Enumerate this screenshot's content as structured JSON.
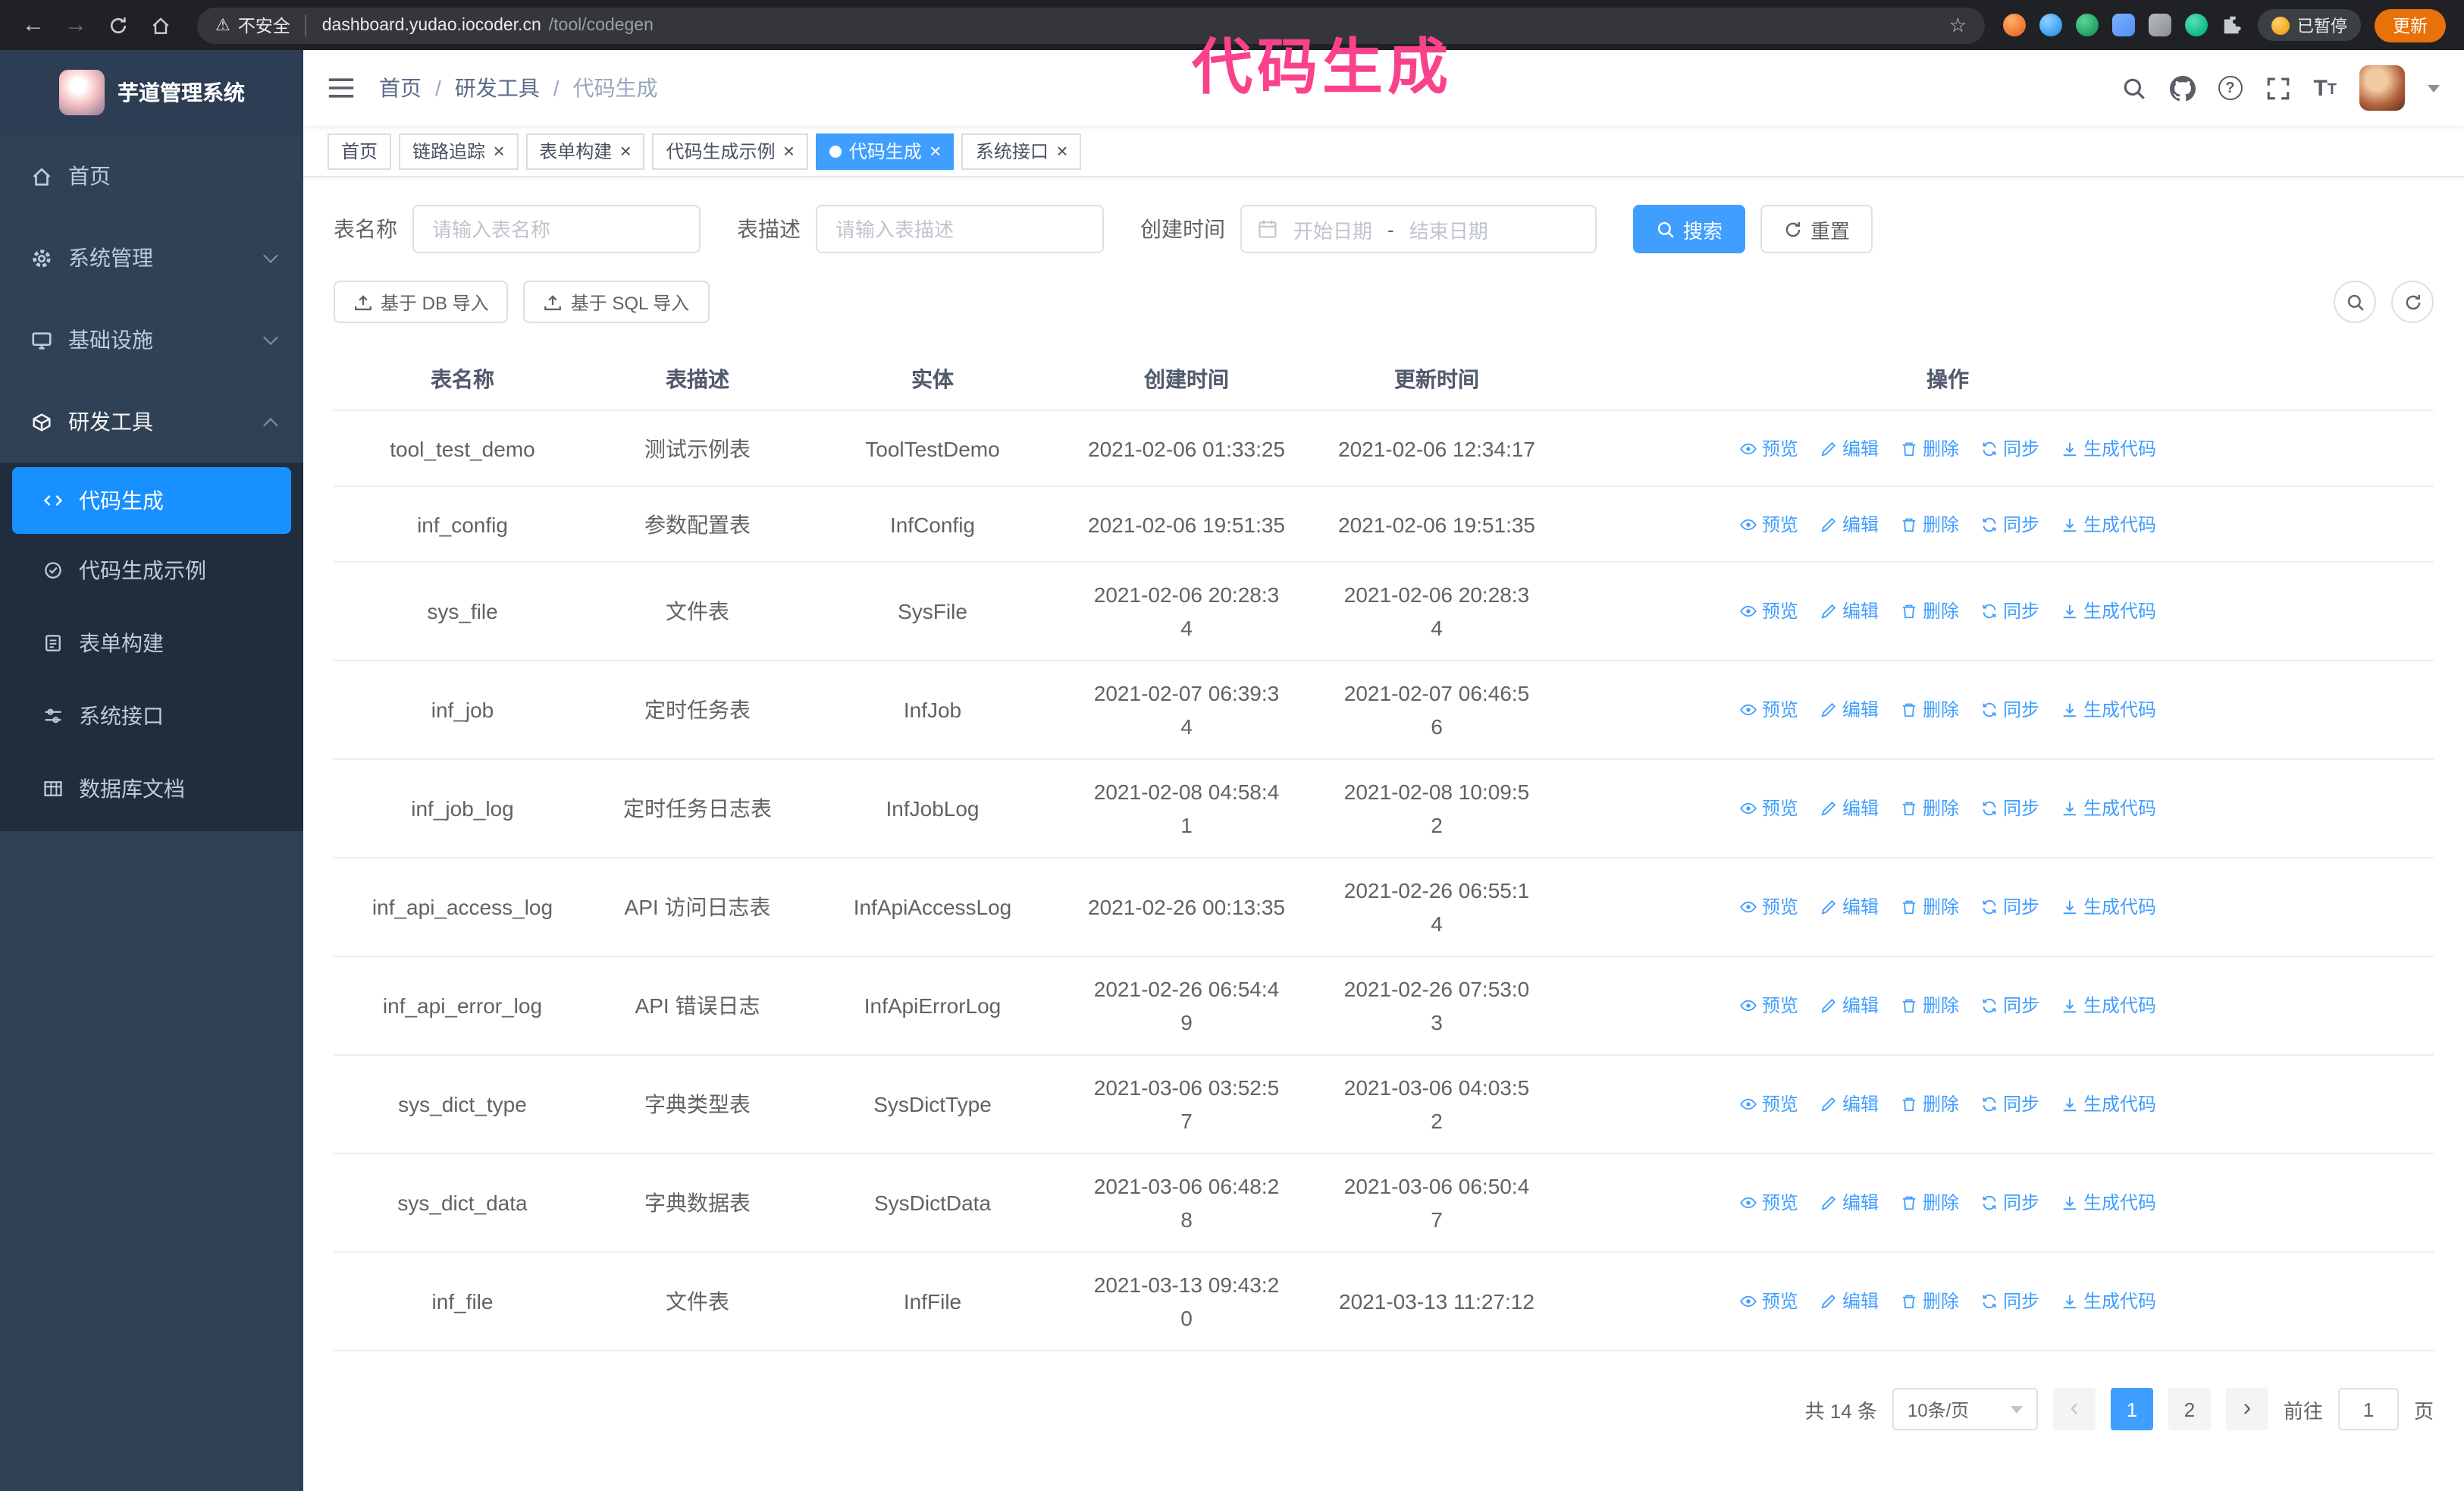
{
  "theme": {
    "accent": "#409eff",
    "sidebar_bg": "#304156",
    "submenu_bg": "#1f2d3d",
    "active_menu_bg": "#1890ff",
    "update_button_bg": "#e8710a",
    "annotation_pink": "#fa418c"
  },
  "browser": {
    "security_label": "不安全",
    "url_host": "dashboard.yudao.iocoder.cn",
    "url_path": "/tool/codegen",
    "paused_badge": "已暂停",
    "update_button": "更新"
  },
  "annotation": {
    "text": "代码生成"
  },
  "glyphs": {
    "back": "←",
    "forward": "→",
    "star": "☆",
    "warning": "⚠",
    "close": "×",
    "crumb_sep": "/",
    "prev": "‹",
    "next": "›",
    "help": "?",
    "font_large": "T",
    "font_small": "T"
  },
  "sidebar": {
    "logo_title": "芋道管理系统",
    "items": [
      {
        "label": "首页"
      },
      {
        "label": "系统管理"
      },
      {
        "label": "基础设施"
      },
      {
        "label": "研发工具"
      }
    ],
    "subitems": [
      {
        "label": "代码生成"
      },
      {
        "label": "代码生成示例"
      },
      {
        "label": "表单构建"
      },
      {
        "label": "系统接口"
      },
      {
        "label": "数据库文档"
      }
    ]
  },
  "breadcrumb": {
    "items": [
      "首页",
      "研发工具",
      "代码生成"
    ]
  },
  "tags": [
    {
      "label": "首页",
      "closable": false,
      "active": false
    },
    {
      "label": "链路追踪",
      "closable": true,
      "active": false
    },
    {
      "label": "表单构建",
      "closable": true,
      "active": false
    },
    {
      "label": "代码生成示例",
      "closable": true,
      "active": false
    },
    {
      "label": "代码生成",
      "closable": true,
      "active": true
    },
    {
      "label": "系统接口",
      "closable": true,
      "active": false
    }
  ],
  "filters": {
    "table_name_label": "表名称",
    "table_name_placeholder": "请输入表名称",
    "table_desc_label": "表描述",
    "table_desc_placeholder": "请输入表描述",
    "create_time_label": "创建时间",
    "date_start_placeholder": "开始日期",
    "date_separator": "-",
    "date_end_placeholder": "结束日期",
    "search_button": "搜索",
    "reset_button": "重置"
  },
  "toolbar": {
    "import_db_button": "基于 DB 导入",
    "import_sql_button": "基于 SQL 导入"
  },
  "table": {
    "columns": [
      "表名称",
      "表描述",
      "实体",
      "创建时间",
      "更新时间",
      "操作"
    ],
    "actions": [
      "预览",
      "编辑",
      "删除",
      "同步",
      "生成代码"
    ],
    "rows": [
      {
        "name": "tool_test_demo",
        "desc": "测试示例表",
        "entity": "ToolTestDemo",
        "created": "2021-02-06 01:33:25",
        "updated": "2021-02-06 12:34:17"
      },
      {
        "name": "inf_config",
        "desc": "参数配置表",
        "entity": "InfConfig",
        "created": "2021-02-06 19:51:35",
        "updated": "2021-02-06 19:51:35"
      },
      {
        "name": "sys_file",
        "desc": "文件表",
        "entity": "SysFile",
        "created": "2021-02-06 20:28:3\n4",
        "updated": "2021-02-06 20:28:3\n4"
      },
      {
        "name": "inf_job",
        "desc": "定时任务表",
        "entity": "InfJob",
        "created": "2021-02-07 06:39:3\n4",
        "updated": "2021-02-07 06:46:5\n6"
      },
      {
        "name": "inf_job_log",
        "desc": "定时任务日志表",
        "entity": "InfJobLog",
        "created": "2021-02-08 04:58:4\n1",
        "updated": "2021-02-08 10:09:5\n2"
      },
      {
        "name": "inf_api_access_log",
        "desc": "API 访问日志表",
        "entity": "InfApiAccessLog",
        "created": "2021-02-26 00:13:35",
        "updated": "2021-02-26 06:55:1\n4"
      },
      {
        "name": "inf_api_error_log",
        "desc": "API 错误日志",
        "entity": "InfApiErrorLog",
        "created": "2021-02-26 06:54:4\n9",
        "updated": "2021-02-26 07:53:0\n3"
      },
      {
        "name": "sys_dict_type",
        "desc": "字典类型表",
        "entity": "SysDictType",
        "created": "2021-03-06 03:52:5\n7",
        "updated": "2021-03-06 04:03:5\n2"
      },
      {
        "name": "sys_dict_data",
        "desc": "字典数据表",
        "entity": "SysDictData",
        "created": "2021-03-06 06:48:2\n8",
        "updated": "2021-03-06 06:50:4\n7"
      },
      {
        "name": "inf_file",
        "desc": "文件表",
        "entity": "InfFile",
        "created": "2021-03-13 09:43:2\n0",
        "updated": "2021-03-13 11:27:12"
      }
    ]
  },
  "pagination": {
    "total": "共 14 条",
    "page_size": "10条/页",
    "page_1": "1",
    "page_2": "2",
    "goto_label": "前往",
    "goto_value": "1",
    "goto_unit": "页"
  }
}
